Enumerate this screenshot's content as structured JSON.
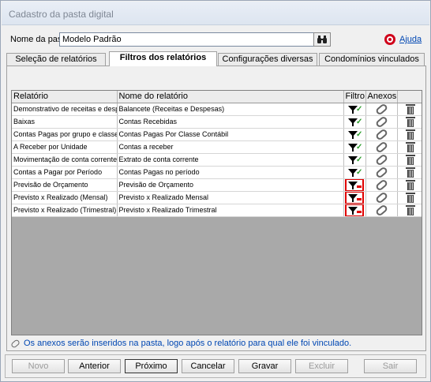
{
  "window": {
    "title": "Cadastro da pasta digital"
  },
  "name_row": {
    "label": "Nome da pasta:",
    "value": "Modelo Padrão",
    "help_label": "Ajuda"
  },
  "tabs": [
    {
      "label": "Seleção de relatórios",
      "active": false
    },
    {
      "label": "Filtros dos relatórios",
      "active": true
    },
    {
      "label": "Configurações diversas",
      "active": false
    },
    {
      "label": "Condomínios vinculados",
      "active": false
    }
  ],
  "grid": {
    "columns": [
      "Relatório",
      "Nome do relatório",
      "Filtro",
      "Anexos"
    ],
    "rows": [
      {
        "relatorio": "Demonstrativo de receitas e despesas",
        "nome": "Balancete (Receitas e Despesas)",
        "filter_set": true
      },
      {
        "relatorio": "Baixas",
        "nome": "Contas Recebidas",
        "filter_set": true
      },
      {
        "relatorio": "Contas Pagas por grupo e classe",
        "nome": "Contas Pagas Por Classe Contábil",
        "filter_set": true
      },
      {
        "relatorio": "A Receber por Unidade",
        "nome": "Contas a receber",
        "filter_set": true
      },
      {
        "relatorio": "Movimentação de conta corrente",
        "nome": "Extrato de conta corrente",
        "filter_set": true
      },
      {
        "relatorio": "Contas a Pagar por Período",
        "nome": "Contas Pagas no período",
        "filter_set": true
      },
      {
        "relatorio": "Previsão de Orçamento",
        "nome": "Previsão de Orçamento",
        "filter_set": false
      },
      {
        "relatorio": "Previsto x Realizado (Mensal)",
        "nome": "Previsto x Realizado Mensal",
        "filter_set": false
      },
      {
        "relatorio": "Previsto x Realizado (Trimestral)",
        "nome": "Previsto x Realizado Trimestral",
        "filter_set": false
      }
    ]
  },
  "note": "Os anexos serão inseridos na pasta, logo após o relatório para qual ele foi vinculado.",
  "buttons": [
    {
      "label": "Novo",
      "enabled": false
    },
    {
      "label": "Anterior",
      "enabled": true
    },
    {
      "label": "Próximo",
      "enabled": true
    },
    {
      "label": "Cancelar",
      "enabled": true
    },
    {
      "label": "Gravar",
      "enabled": true
    },
    {
      "label": "Excluir",
      "enabled": false
    },
    {
      "label": "Sair",
      "enabled": false
    }
  ],
  "colors": {
    "highlight": "#e00000",
    "check": "#2a9d2a",
    "link": "#0047b3"
  },
  "icons": {
    "find": "binoculars-icon",
    "help": "help-icon",
    "filter": "filter-icon",
    "attach": "paperclip-icon",
    "delete": "trash-icon"
  }
}
